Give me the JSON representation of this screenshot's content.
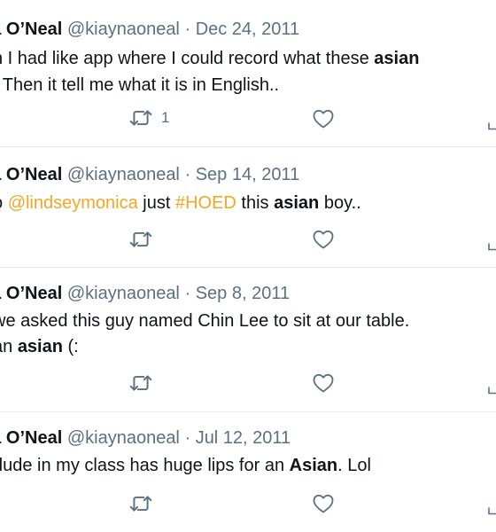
{
  "tweets": [
    {
      "name": "na O’Neal",
      "handle": "@kiaynaoneal",
      "separator": "·",
      "date": "Dec 24, 2011",
      "line1": [
        {
          "t": "n I had like app where I could record what these "
        },
        {
          "t": "asian",
          "b": true
        }
      ],
      "line2": [
        {
          "t": ". Then it tell me what it is in English.."
        }
      ],
      "retweet_count": "1"
    },
    {
      "name": "na O’Neal",
      "handle": "@kiaynaoneal",
      "separator": "·",
      "date": "Sep 14, 2011",
      "line1": [
        {
          "t": "o "
        },
        {
          "t": "@lindseymonica",
          "cls": "mention"
        },
        {
          "t": " just "
        },
        {
          "t": "#HOED",
          "cls": "hashtag"
        },
        {
          "t": " this "
        },
        {
          "t": "asian",
          "b": true
        },
        {
          "t": " boy.."
        }
      ],
      "retweet_count": ""
    },
    {
      "name": "na O’Neal",
      "handle": "@kiaynaoneal",
      "separator": "·",
      "date": "Sep 8, 2011",
      "line1": [
        {
          "t": "we asked this guy named Chin Lee to sit at our table."
        }
      ],
      "line2": [
        {
          "t": "an "
        },
        {
          "t": "asian",
          "b": true
        },
        {
          "t": " (:"
        }
      ],
      "retweet_count": ""
    },
    {
      "name": "na O’Neal",
      "handle": "@kiaynaoneal",
      "separator": "·",
      "date": "Jul 12, 2011",
      "line1": [
        {
          "t": "dude in my class has huge lips for an "
        },
        {
          "t": "Asian",
          "b": true
        },
        {
          "t": ". Lol"
        }
      ],
      "retweet_count": ""
    }
  ],
  "icons": {
    "retweet": "retweet-icon",
    "like": "heart-icon",
    "share": "share-icon"
  },
  "colors": {
    "link": "#f5a623",
    "muted": "#5b7083",
    "text": "#0f1419",
    "divider": "#e6ecf0"
  }
}
